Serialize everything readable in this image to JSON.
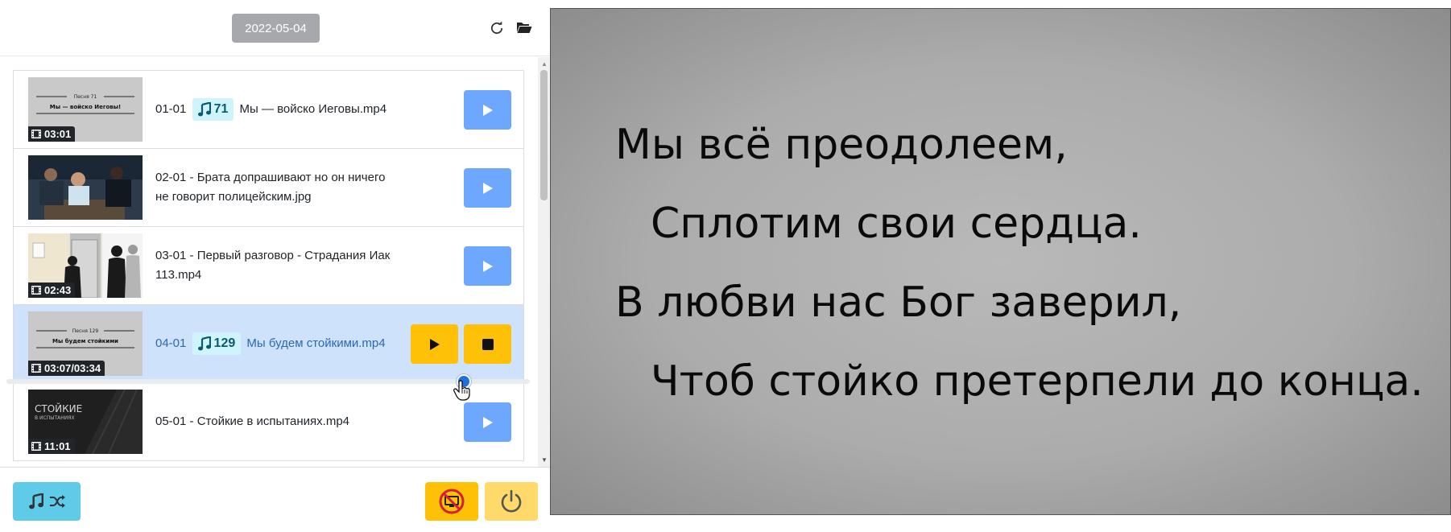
{
  "header": {
    "date": "2022-05-04"
  },
  "playlist": [
    {
      "code": "01-01",
      "song_number": "71",
      "title_rest": "Мы — войско Иеговы.mp4",
      "duration": "03:01",
      "thumb_heading": "Песня 71",
      "thumb_title": "Мы — войско Иеговы!",
      "active": false
    },
    {
      "code": "02-01",
      "song_number": "",
      "title_rest": "- Брата допрашивают но он ничего не говорит полицейским.jpg",
      "duration": "",
      "active": false
    },
    {
      "code": "03-01",
      "song_number": "",
      "title_rest": "- Первый разговор - Страдания Иак 113.mp4",
      "duration": "02:43",
      "active": false
    },
    {
      "code": "04-01",
      "song_number": "129",
      "title_rest": "Мы будем стойкими.mp4",
      "duration": "03:07/03:34",
      "thumb_heading": "Песня 129",
      "thumb_title": "Мы будем стойкими",
      "active": true
    },
    {
      "code": "05-01",
      "song_number": "",
      "title_rest": "- Стойкие в испытаниях.mp4",
      "duration": "11:01",
      "thumb_heading": "СТОЙКИЕ",
      "thumb_title": "В ИСПЫТАНИЯХ",
      "active": false
    }
  ],
  "playback": {
    "progress": 0.874
  },
  "lyrics": [
    "Мы всё преодолеем,",
    "Сплотим свои сердца.",
    "В любви нас Бог заверил,",
    "Чтоб стойко претерпели до конца."
  ],
  "colors": {
    "primary_light": "#6ea8fe",
    "warning": "#ffc107",
    "warning_light": "#ffda6a",
    "info": "#5fcbe8",
    "secondary": "#a6a8ab",
    "active_row": "#cfe2fb"
  },
  "icons": {
    "refresh": "refresh-icon",
    "folder": "folder-open-icon",
    "play": "play-icon",
    "stop": "stop-icon",
    "film": "film-icon",
    "music": "music-note-icon",
    "shuffle": "shuffle-icon",
    "screen_off": "monitor-off-icon",
    "power": "power-icon"
  }
}
